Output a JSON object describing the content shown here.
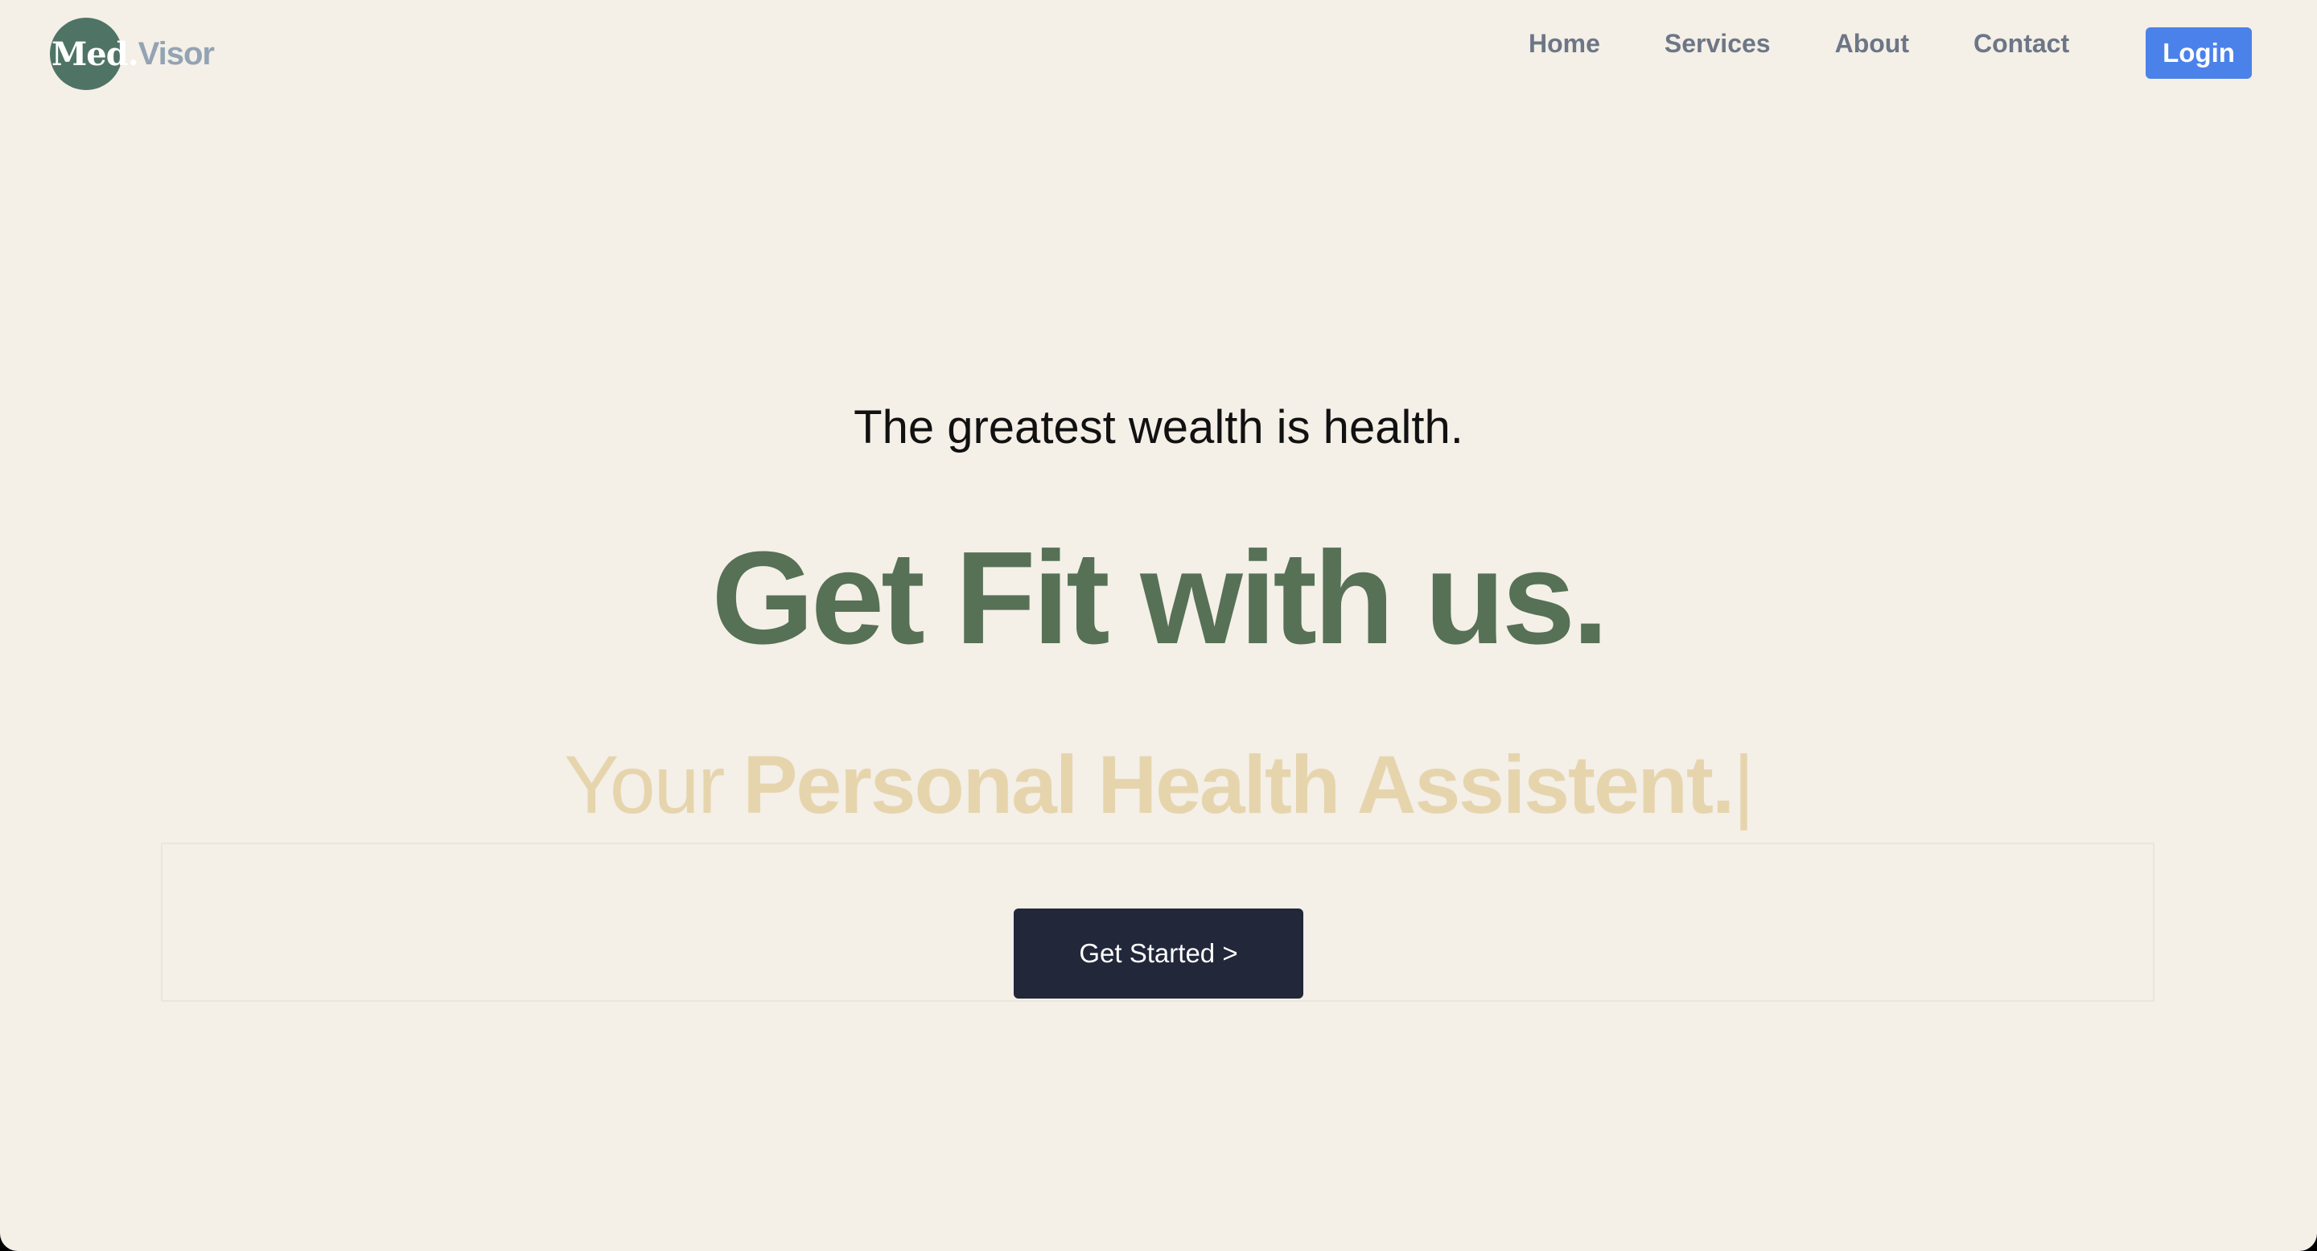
{
  "brand": {
    "logo_med": "Med.",
    "logo_visor": "Visor",
    "logo_circle_color": "#4f7466"
  },
  "nav": {
    "links": [
      {
        "label": "Home"
      },
      {
        "label": "Services"
      },
      {
        "label": "About"
      },
      {
        "label": "Contact"
      }
    ],
    "login_label": "Login",
    "login_color": "#4b82ea"
  },
  "hero": {
    "tagline": "The greatest wealth is health.",
    "headline": "Get Fit with us.",
    "subline_prefix": "Your",
    "subline_typed": "Personal Health Assistent.",
    "subline_cursor": "|",
    "cta_label": "Get Started >"
  },
  "colors": {
    "background": "#f4efe7",
    "headline": "#567155",
    "subline": "#e6d5ac",
    "cta": "#22273a"
  }
}
